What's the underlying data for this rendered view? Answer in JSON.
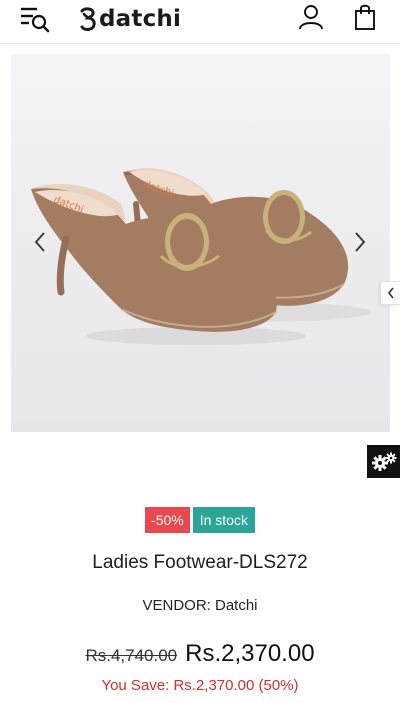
{
  "header": {
    "brand": "datchi",
    "menu_icon": "menu-search-icon",
    "account_icon": "user-icon",
    "cart_icon": "shopping-bag-icon"
  },
  "gallery": {
    "prev_icon": "chevron-left-icon",
    "next_icon": "chevron-right-icon"
  },
  "side_panel": {
    "tab_icon": "chevron-left-icon",
    "settings_icon": "gears-icon"
  },
  "product": {
    "discount_badge": "-50%",
    "stock_badge": "In stock",
    "title": "Ladies Footwear-DLS272",
    "vendor": "VENDOR: Datchi",
    "old_price": "Rs.4,740.00",
    "price": "Rs.2,370.00",
    "you_save": "You Save: Rs.2,370.00 (50%)"
  },
  "colors": {
    "sale_badge": "#e8484e",
    "stock_badge": "#2aa597",
    "save_text": "#d32f2f",
    "shoe": "#a37c62"
  }
}
